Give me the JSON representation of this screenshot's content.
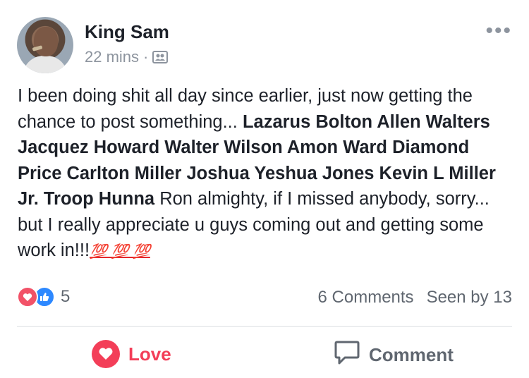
{
  "post": {
    "author": "King Sam",
    "time": "22 mins",
    "separator": "·",
    "privacy_icon": "friends-icon",
    "more_icon": "more-dots-icon",
    "text_intro": "I been doing shit all day since earlier, just now getting the chance to post something... ",
    "tagged": "Lazarus Bolton Allen Walters Jacquez Howard Walter Wilson Amon Ward Diamond Price Carlton Miller Joshua Yeshua Jones Kevin L Miller Jr. Troop Hunna",
    "text_outro": " Ron almighty, if I missed anybody, sorry... but I really appreciate u guys coming out and getting some work in!!!",
    "emojis": "💯 💯 💯"
  },
  "reactions": {
    "count": "5",
    "types": [
      "love-icon",
      "like-icon"
    ]
  },
  "stats": {
    "comments": "6 Comments",
    "seen": "Seen by 13"
  },
  "actions": {
    "love_label": "Love",
    "comment_label": "Comment"
  },
  "colors": {
    "love": "#f33e58",
    "like": "#2d88ff",
    "secondary_text": "#606770"
  }
}
